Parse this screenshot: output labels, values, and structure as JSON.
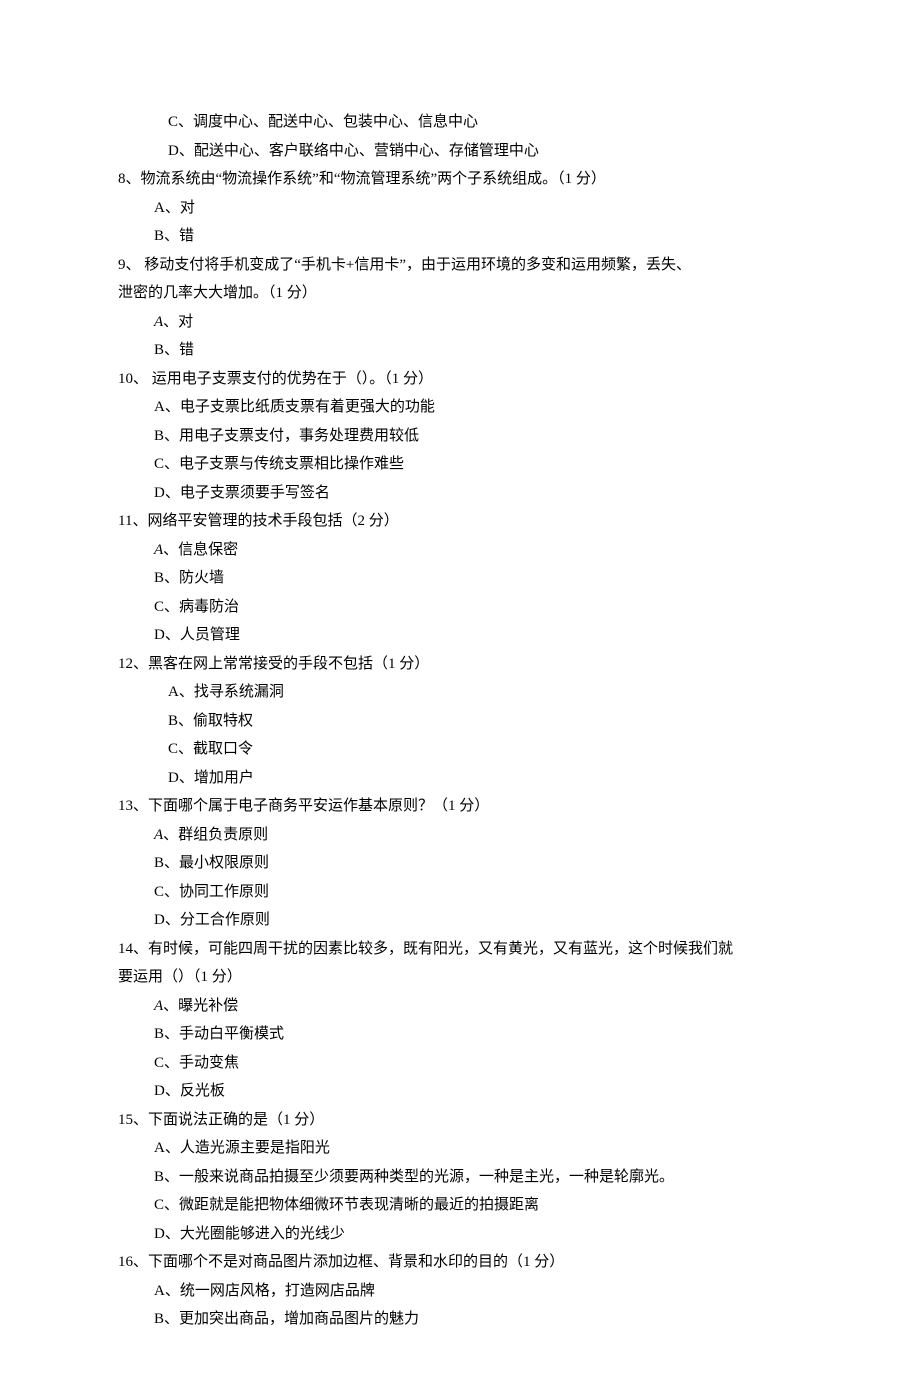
{
  "lines": [
    {
      "cls": "option-deep",
      "text": "C、调度中心、配送中心、包装中心、信息中心"
    },
    {
      "cls": "option-deep",
      "text": "D、配送中心、客户联络中心、营销中心、存储管理中心"
    },
    {
      "cls": "question",
      "text": "8、物流系统由“物流操作系统”和“物流管理系统”两个子系统组成。（1 分）"
    },
    {
      "cls": "option",
      "text": "A、对"
    },
    {
      "cls": "option",
      "text": "B、错"
    },
    {
      "cls": "question",
      "text": "9、   移动支付将手机变成了“手机卡+信用卡”，由于运用环境的多变和运用频繁，丢失、"
    },
    {
      "cls": "question-cont",
      "text": "泄密的几率大大增加。（1 分）"
    },
    {
      "cls": "option",
      "latin": true,
      "text": "A、对"
    },
    {
      "cls": "option",
      "text": "B、错"
    },
    {
      "cls": "question",
      "text": "10、  运用电子支票支付的优势在于（）。（1 分）"
    },
    {
      "cls": "option",
      "text": "A、电子支票比纸质支票有着更强大的功能"
    },
    {
      "cls": "option",
      "text": "B、用电子支票支付，事务处理费用较低"
    },
    {
      "cls": "option",
      "text": "C、电子支票与传统支票相比操作难些"
    },
    {
      "cls": "option",
      "text": "D、电子支票须要手写签名"
    },
    {
      "cls": "question",
      "text": "11、网络平安管理的技术手段包括（2 分）"
    },
    {
      "cls": "option",
      "latin": true,
      "text": "A、信息保密"
    },
    {
      "cls": "option",
      "text": "B、防火墙"
    },
    {
      "cls": "option",
      "text": "C、病毒防治"
    },
    {
      "cls": "option",
      "text": "D、人员管理"
    },
    {
      "cls": "question",
      "text": "12、黑客在网上常常接受的手段不包括（1 分）"
    },
    {
      "cls": "option-deep",
      "text": "A、找寻系统漏洞"
    },
    {
      "cls": "option-deep",
      "text": "B、偷取特权"
    },
    {
      "cls": "option-deep",
      "text": "C、截取口令"
    },
    {
      "cls": "option-deep",
      "text": "D、增加用户"
    },
    {
      "cls": "question",
      "text": "13、下面哪个属于电子商务平安运作基本原则？（1 分）"
    },
    {
      "cls": "option",
      "latin": true,
      "text": "A、群组负责原则"
    },
    {
      "cls": "option",
      "text": "B、最小权限原则"
    },
    {
      "cls": "option",
      "text": "C、协同工作原则"
    },
    {
      "cls": "option",
      "text": "D、分工合作原则"
    },
    {
      "cls": "question",
      "text": "14、有时候，可能四周干扰的因素比较多，既有阳光，又有黄光，又有蓝光，这个时候我们就"
    },
    {
      "cls": "question-cont",
      "text": "要运用（）（1 分）"
    },
    {
      "cls": "option",
      "latin": true,
      "text": "A、曝光补偿"
    },
    {
      "cls": "option",
      "text": "B、手动白平衡模式"
    },
    {
      "cls": "option",
      "text": "C、手动变焦"
    },
    {
      "cls": "option",
      "text": "D、反光板"
    },
    {
      "cls": "question",
      "text": "15、下面说法正确的是（1 分）"
    },
    {
      "cls": "option",
      "text": "A、人造光源主要是指阳光"
    },
    {
      "cls": "option",
      "text": "B、一般来说商品拍摄至少须要两种类型的光源，一种是主光，一种是轮廓光。"
    },
    {
      "cls": "option",
      "text": "C、微距就是能把物体细微环节表现清晰的最近的拍摄距离"
    },
    {
      "cls": "option",
      "text": "D、大光圈能够进入的光线少"
    },
    {
      "cls": "question",
      "text": "16、下面哪个不是对商品图片添加边框、背景和水印的目的（1 分）"
    },
    {
      "cls": "option",
      "text": "A、统一网店风格，打造网店品牌"
    },
    {
      "cls": "option",
      "text": "B、更加突出商品，增加商品图片的魅力"
    }
  ]
}
